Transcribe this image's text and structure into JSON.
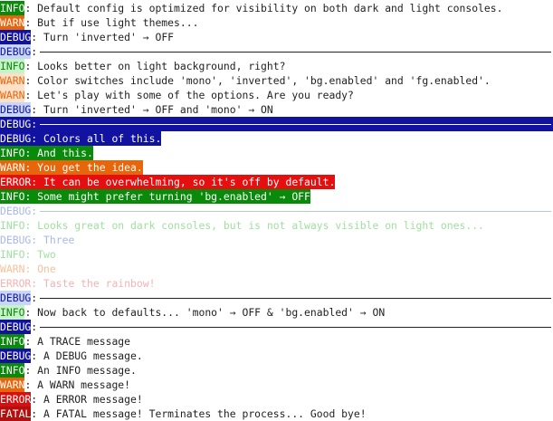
{
  "console": {
    "lines": [
      {
        "level": "INFO",
        "sep": ": ",
        "text": "Default config is optimized for visibility on both dark and light consoles.",
        "style": "chip"
      },
      {
        "level": "WARN",
        "sep": ": ",
        "text": "But if use light themes...",
        "style": "chip"
      },
      {
        "level": "DEBUG",
        "sep": ": ",
        "text": "Turn 'inverted' → OFF",
        "style": "chip"
      },
      {
        "level": "DEBUG",
        "sep": ":",
        "text": "",
        "style": "pastel",
        "rule": true
      },
      {
        "level": "INFO",
        "sep": ": ",
        "text": "Looks better on light background, right?",
        "style": "pastel"
      },
      {
        "level": "WARN",
        "sep": ": ",
        "text": "Color switches include 'mono', 'inverted', 'bg.enabled' and 'fg.enabled'.",
        "style": "pastel"
      },
      {
        "level": "WARN",
        "sep": ": ",
        "text": "Let's play with some of the options. Are you ready?",
        "style": "pastel"
      },
      {
        "level": "DEBUG",
        "sep": ": ",
        "text": "Turn 'inverted' → OFF and 'mono' → ON",
        "style": "pastel"
      },
      {
        "level": "DEBUG",
        "sep": ":",
        "text": "",
        "style": "bg",
        "rule": true
      },
      {
        "level": "DEBUG",
        "sep": ": ",
        "text": "Colors all of this.",
        "style": "bg"
      },
      {
        "level": "INFO",
        "sep": ": ",
        "text": "And this.",
        "style": "bg"
      },
      {
        "level": "WARN",
        "sep": ": ",
        "text": "You get the idea.",
        "style": "bg"
      },
      {
        "level": "ERROR",
        "sep": ": ",
        "text": "It can be overwhelming, so it's off by default.",
        "style": "bg"
      },
      {
        "level": "INFO",
        "sep": ": ",
        "text": "Some might prefer turning 'bg.enabled' → OFF",
        "style": "bg"
      },
      {
        "level": "DEBUG",
        "sep": ":",
        "text": "",
        "style": "light",
        "rule": true
      },
      {
        "level": "INFO",
        "sep": ": ",
        "text": "Looks great on dark consoles, but is not always visible on light ones...",
        "style": "light"
      },
      {
        "level": "DEBUG",
        "sep": ": ",
        "text": "Three",
        "style": "light"
      },
      {
        "level": "INFO",
        "sep": ": ",
        "text": "Two",
        "style": "light"
      },
      {
        "level": "WARN",
        "sep": ": ",
        "text": "One",
        "style": "light"
      },
      {
        "level": "ERROR",
        "sep": ": ",
        "text": "Taste the rainbow!",
        "style": "light"
      },
      {
        "level": "DEBUG",
        "sep": ":",
        "text": "",
        "style": "lightchip",
        "rule": true
      },
      {
        "level": "INFO",
        "sep": ": ",
        "text": "Now back to defaults... 'mono' → OFF & 'bg.enabled' → ON",
        "style": "lightchip"
      },
      {
        "level": "DEBUG",
        "sep": ":",
        "text": "",
        "style": "chip",
        "rule": true
      },
      {
        "level": "INFO",
        "sep": ": ",
        "text": "A TRACE message",
        "style": "chip"
      },
      {
        "level": "DEBUG",
        "sep": ": ",
        "text": "A DEBUG message.",
        "style": "chip"
      },
      {
        "level": "INFO",
        "sep": ": ",
        "text": "An INFO message.",
        "style": "chip"
      },
      {
        "level": "WARN",
        "sep": ": ",
        "text": "A WARN message!",
        "style": "chip"
      },
      {
        "level": "ERROR",
        "sep": ": ",
        "text": "A ERROR message!",
        "style": "chip"
      },
      {
        "level": "FATAL",
        "sep": ": ",
        "text": "A FATAL message! Terminates the process... Good bye!",
        "style": "chip"
      }
    ]
  },
  "colors": {
    "info": "#0a8a0a",
    "warn": "#e8660a",
    "debug": "#1212a0",
    "error": "#d61010",
    "fatal": "#b01010"
  }
}
